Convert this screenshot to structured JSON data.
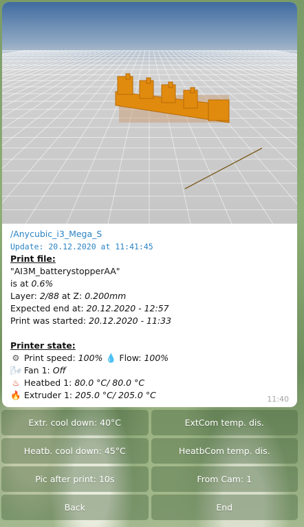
{
  "message": {
    "chat_link": "/Anycubic_i3_Mega_S",
    "update_line": "Update: 20.12.2020 at 11:41:45",
    "print_file_header": "Print file:",
    "file_name": "\"AI3M_batterystopperAA\"",
    "progress_label": "is at",
    "progress_value": "0.6%",
    "layer_label": "Layer:",
    "layer_value": "2/88",
    "z_label": "at Z:",
    "z_value": "0.200mm",
    "expected_end_label": "Expected end at:",
    "expected_end_value": "20.12.2020 - 12:57",
    "started_label": "Print was started:",
    "started_value": "20.12.2020 - 11:33",
    "printer_state_header": "Printer state:",
    "print_speed_label": "Print speed:",
    "print_speed_value": "100%",
    "flow_label": "Flow:",
    "flow_value": "100%",
    "fan_label": "Fan 1:",
    "fan_value": "Off",
    "heatbed_label": "Heatbed 1:",
    "heatbed_value": "80.0 °C/ 80.0 °C",
    "extruder_label": "Extruder 1:",
    "extruder_value": "205.0 °C/ 205.0 °C",
    "time": "11:40"
  },
  "icons": {
    "gear": "⚙",
    "droplet": "💧",
    "fan": "🌬",
    "hot": "♨",
    "fire": "🔥"
  },
  "keyboard": {
    "extr_cool": "Extr. cool down: 40°C",
    "extcom": "ExtCom temp. dis.",
    "heatb_cool": "Heatb. cool down: 45°C",
    "heatbcom": "HeatbCom temp. dis.",
    "pic_after": "Pic after print: 10s",
    "from_cam": "From Cam: 1",
    "back": "Back",
    "end": "End"
  }
}
